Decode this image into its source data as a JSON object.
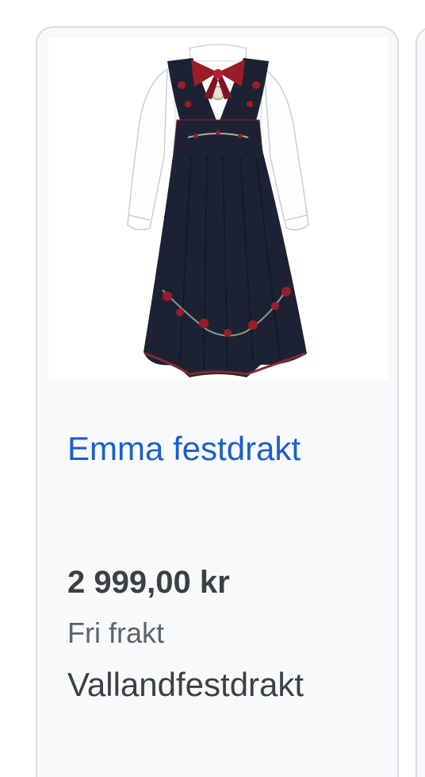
{
  "product": {
    "image_alt": "product-photo",
    "title": "Emma festdrakt",
    "price": "2 999,00 kr",
    "shipping": "Fri frakt",
    "seller": "Vallandfestdrakt"
  },
  "colors": {
    "title_link": "#1a5fd0",
    "price": "#3c4043",
    "shipping": "#5f6368",
    "card_background": "#f8f9fa",
    "card_border": "#dadce0",
    "dress_navy": "#1c2233",
    "bow_red": "#9b1c28"
  }
}
